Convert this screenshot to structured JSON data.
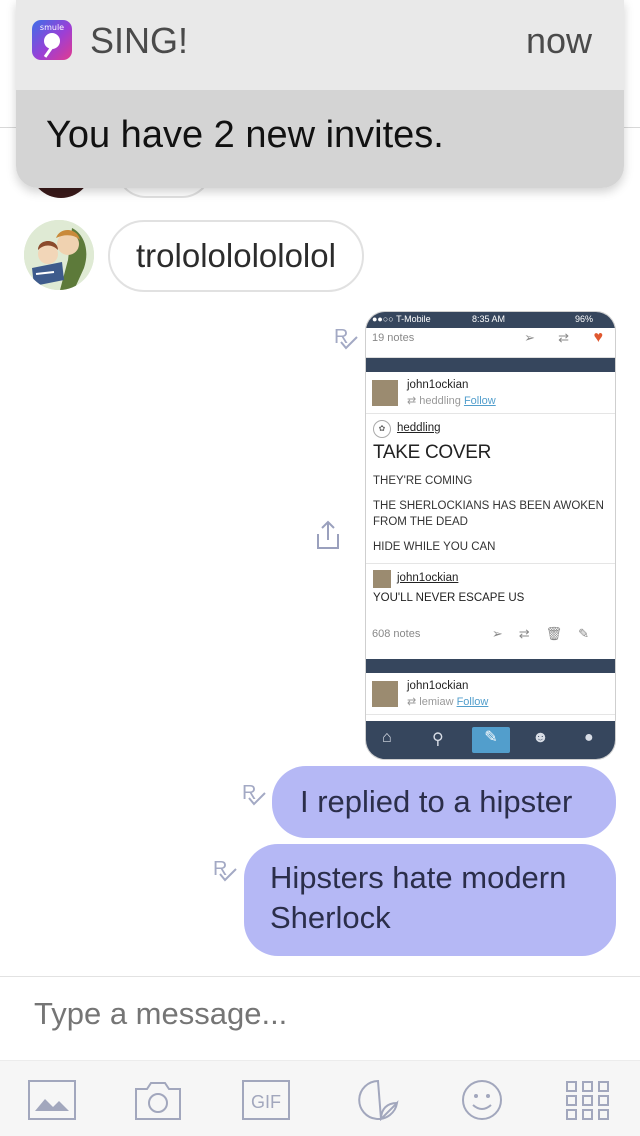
{
  "notification": {
    "app_name": "SING!",
    "app_icon_text": "smule",
    "time": "now",
    "message": "You have 2 new invites."
  },
  "chat": {
    "incoming": [
      {
        "text": "trololololololol"
      }
    ],
    "outgoing": [
      {
        "text": "I replied to a hipster"
      },
      {
        "text": "Hipsters hate modern Sherlock"
      }
    ],
    "read_mark": "R"
  },
  "embedded_screenshot": {
    "status": {
      "carrier": "●●○○ T-Mobile",
      "time": "8:35 AM",
      "battery": "96%"
    },
    "top_notes": "19 notes",
    "rows": [
      {
        "name": "john1ockian",
        "reblogged_from": "heddling",
        "follow": "Follow"
      },
      {
        "name": "john1ockian",
        "reblogged_from": "lemiaw",
        "follow": "Follow"
      }
    ],
    "post": {
      "author": "heddling",
      "title": "TAKE COVER",
      "lines": [
        "THEY'RE COMING",
        "THE SHERLOCKIANS HAS BEEN AWOKEN FROM THE DEAD",
        "HIDE WHILE YOU CAN"
      ]
    },
    "reply": {
      "author": "john1ockian",
      "text": "YOU'LL NEVER ESCAPE US",
      "notes": "608 notes"
    }
  },
  "composer": {
    "placeholder": "Type a message..."
  },
  "toolbar": {
    "gif_label": "GIF",
    "icons": [
      "image-icon",
      "camera-icon",
      "gif-icon",
      "sticker-icon",
      "emoji-icon",
      "grid-icon"
    ]
  },
  "colors": {
    "outgoing_bubble": "#b5b8f5",
    "tumblr_navy": "#36465d",
    "tumblr_link": "#529ecc"
  }
}
